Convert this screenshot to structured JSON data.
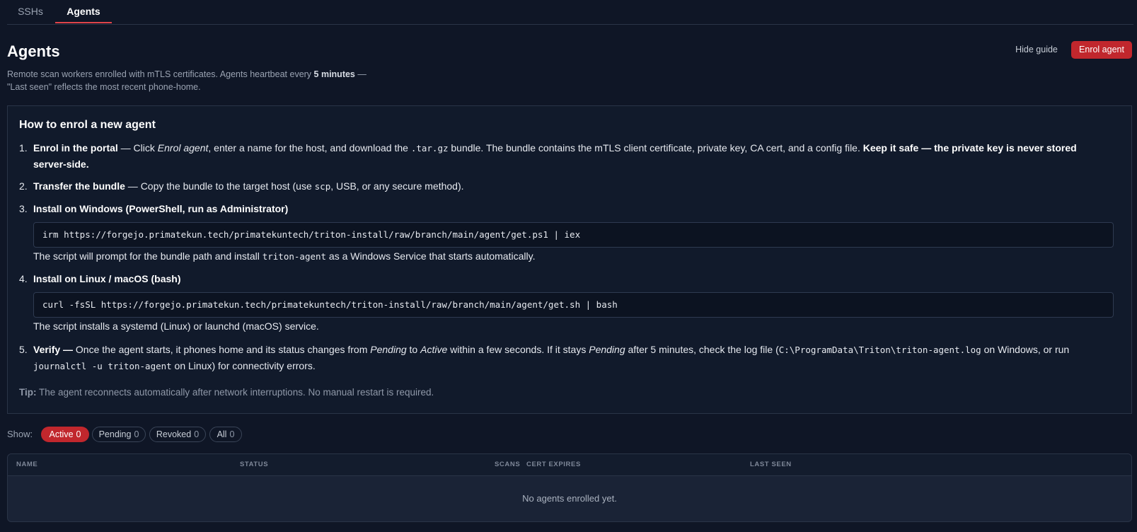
{
  "tabs": [
    {
      "label": "SSHs"
    },
    {
      "label": "Agents"
    }
  ],
  "header": {
    "title": "Agents",
    "subtitle_a": "Remote scan workers enrolled with mTLS certificates. Agents heartbeat every ",
    "subtitle_b": "5 minutes",
    "subtitle_c": " —",
    "subtitle_d": "\"Last seen\" reflects the most recent phone-home.",
    "hide_guide_label": "Hide guide",
    "enrol_label": "Enrol agent"
  },
  "guide": {
    "title": "How to enrol a new agent",
    "steps": [
      {
        "num": "1.",
        "title": "Enrol in the portal",
        "t1": " — Click ",
        "em": "Enrol agent",
        "t2": ", enter a name for the host, and download the ",
        "code": ".tar.gz",
        "t3": " bundle. The bundle contains the mTLS client certificate, private key, CA cert, and a config file. ",
        "bold": "Keep it safe — the private key is never stored",
        "bold2": "server-side."
      },
      {
        "num": "2.",
        "title": "Transfer the bundle",
        "t1": " — Copy the bundle to the target host (use ",
        "code": "scp",
        "t2": ", USB, or any secure method)."
      },
      {
        "num": "3.",
        "title": "Install on Windows (PowerShell, run as Administrator)",
        "command": "irm https://forgejo.primatekun.tech/primatekuntech/triton-install/raw/branch/main/agent/get.ps1 | iex",
        "note_a": "The script will prompt for the bundle path and install ",
        "note_code": "triton-agent",
        "note_b": " as a Windows Service that starts automatically."
      },
      {
        "num": "4.",
        "title": "Install on Linux / macOS (bash)",
        "command": "curl -fsSL https://forgejo.primatekun.tech/primatekuntech/triton-install/raw/branch/main/agent/get.sh | bash",
        "note": "The script installs a systemd (Linux) or launchd (macOS) service."
      },
      {
        "num": "5.",
        "title": "Verify —",
        "t1": " Once the agent starts, it phones home and its status changes from ",
        "em1": "Pending",
        "t2": " to ",
        "em2": "Active",
        "t3": " within a few seconds. If it stays ",
        "em3": "Pending",
        "t4": " after 5 minutes, check the log file (",
        "code1": "C:\\ProgramData\\Triton\\triton-agent.log",
        "t5": " on Windows, or run",
        "code2": "journalctl -u triton-agent",
        "t6": " on Linux) for connectivity errors."
      }
    ],
    "tip_label": "Tip:",
    "tip_text": " The agent reconnects automatically after network interruptions. No manual restart is required."
  },
  "filters": {
    "label": "Show:",
    "options": [
      {
        "label": "Active",
        "count": "0",
        "selected": true
      },
      {
        "label": "Pending",
        "count": "0",
        "selected": false
      },
      {
        "label": "Revoked",
        "count": "0",
        "selected": false
      },
      {
        "label": "All",
        "count": "0",
        "selected": false
      }
    ]
  },
  "table": {
    "columns": [
      "NAME",
      "STATUS",
      "SCANS",
      "CERT EXPIRES",
      "LAST SEEN"
    ],
    "empty_text": "No agents enrolled yet."
  },
  "colors": {
    "background": "#0f1626",
    "accent": "#c1272d",
    "tab_underline": "#e0444a"
  }
}
